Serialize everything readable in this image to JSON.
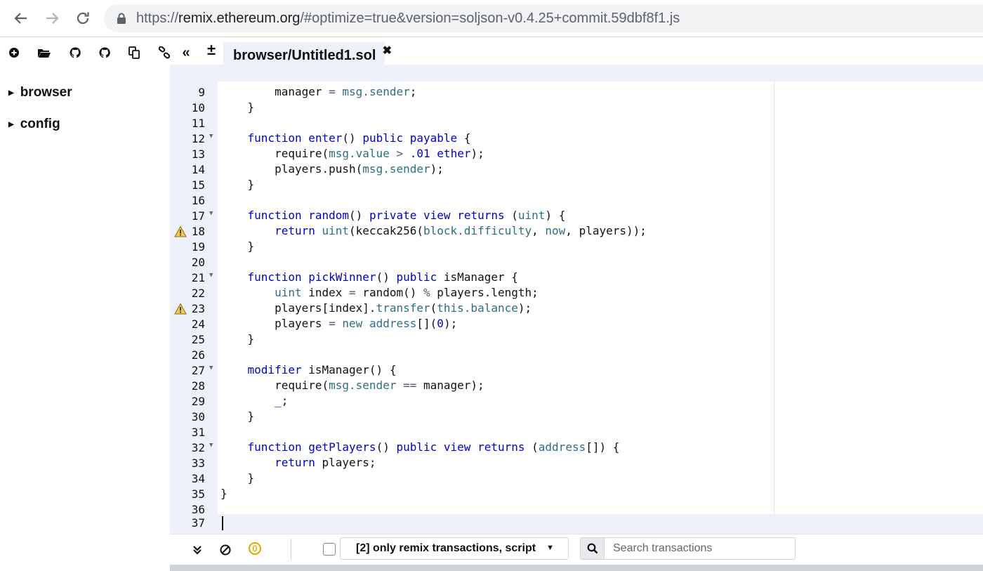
{
  "browser": {
    "url_scheme": "https://",
    "url_host": "remix.ethereum.org",
    "url_rest": "/#optimize=true&version=soljson-v0.4.25+commit.59dbf8f1.js"
  },
  "toolbar": {
    "icons": [
      "plus-circle-icon",
      "folder-open-icon",
      "github-icon",
      "github-icon",
      "copy-icon",
      "link-icon",
      "double-chevron-left-icon",
      "plus-minus-icon"
    ],
    "collapse_glyph": "«",
    "plus_minus_glyph": "±"
  },
  "file_explorer": {
    "items": [
      {
        "label": "browser"
      },
      {
        "label": "config"
      }
    ]
  },
  "editor": {
    "tab_label": "browser/Untitled1.sol",
    "tab_close": "✖",
    "lines": [
      {
        "num": "9",
        "fold": false,
        "warning": false,
        "tokens": [
          [
            "",
            "        manager "
          ],
          [
            "op",
            "="
          ],
          [
            "",
            " "
          ],
          [
            "vr",
            "msg.sender"
          ],
          [
            "",
            ";"
          ]
        ]
      },
      {
        "num": "10",
        "fold": false,
        "warning": false,
        "tokens": [
          [
            "",
            "    }"
          ]
        ]
      },
      {
        "num": "11",
        "fold": false,
        "warning": false,
        "tokens": []
      },
      {
        "num": "12",
        "fold": true,
        "warning": false,
        "tokens": [
          [
            "",
            "    "
          ],
          [
            "kw",
            "function"
          ],
          [
            "",
            " "
          ],
          [
            "kw",
            "enter"
          ],
          [
            "",
            "() "
          ],
          [
            "kw",
            "public"
          ],
          [
            "",
            " "
          ],
          [
            "kw",
            "payable"
          ],
          [
            "",
            " {"
          ]
        ]
      },
      {
        "num": "13",
        "fold": false,
        "warning": false,
        "tokens": [
          [
            "",
            "        require("
          ],
          [
            "vr",
            "msg.value"
          ],
          [
            "",
            " "
          ],
          [
            "op",
            ">"
          ],
          [
            "",
            " "
          ],
          [
            "nm",
            ".01"
          ],
          [
            "",
            " "
          ],
          [
            "kw",
            "ether"
          ],
          [
            "",
            ");"
          ]
        ]
      },
      {
        "num": "14",
        "fold": false,
        "warning": false,
        "tokens": [
          [
            "",
            "        players.push("
          ],
          [
            "vr",
            "msg.sender"
          ],
          [
            "",
            ");"
          ]
        ]
      },
      {
        "num": "15",
        "fold": false,
        "warning": false,
        "tokens": [
          [
            "",
            "    }"
          ]
        ]
      },
      {
        "num": "16",
        "fold": false,
        "warning": false,
        "tokens": []
      },
      {
        "num": "17",
        "fold": true,
        "warning": false,
        "tokens": [
          [
            "",
            "    "
          ],
          [
            "kw",
            "function"
          ],
          [
            "",
            " "
          ],
          [
            "kw",
            "random"
          ],
          [
            "",
            "() "
          ],
          [
            "kw",
            "private"
          ],
          [
            "",
            " "
          ],
          [
            "kw",
            "view"
          ],
          [
            "",
            " "
          ],
          [
            "kw",
            "returns"
          ],
          [
            "",
            " ("
          ],
          [
            "ty",
            "uint"
          ],
          [
            "",
            ") {"
          ]
        ]
      },
      {
        "num": "18",
        "fold": false,
        "warning": true,
        "tokens": [
          [
            "",
            "        "
          ],
          [
            "kw",
            "return"
          ],
          [
            "",
            " "
          ],
          [
            "ty",
            "uint"
          ],
          [
            "",
            "(keccak256("
          ],
          [
            "vr",
            "block.difficulty"
          ],
          [
            "",
            ", "
          ],
          [
            "vr",
            "now"
          ],
          [
            "",
            ", players));"
          ]
        ]
      },
      {
        "num": "19",
        "fold": false,
        "warning": false,
        "tokens": [
          [
            "",
            "    }"
          ]
        ]
      },
      {
        "num": "20",
        "fold": false,
        "warning": false,
        "tokens": []
      },
      {
        "num": "21",
        "fold": true,
        "warning": false,
        "tokens": [
          [
            "",
            "    "
          ],
          [
            "kw",
            "function"
          ],
          [
            "",
            " "
          ],
          [
            "kw",
            "pickWinner"
          ],
          [
            "",
            "() "
          ],
          [
            "kw",
            "public"
          ],
          [
            "",
            " isManager {"
          ]
        ]
      },
      {
        "num": "22",
        "fold": false,
        "warning": false,
        "tokens": [
          [
            "",
            "        "
          ],
          [
            "ty",
            "uint"
          ],
          [
            "",
            " index "
          ],
          [
            "op",
            "="
          ],
          [
            "",
            " random() "
          ],
          [
            "op",
            "%"
          ],
          [
            "",
            " players.length;"
          ]
        ]
      },
      {
        "num": "23",
        "fold": false,
        "warning": true,
        "tokens": [
          [
            "",
            "        players[index]."
          ],
          [
            "vr",
            "transfer"
          ],
          [
            "",
            "("
          ],
          [
            "vr",
            "this.balance"
          ],
          [
            "",
            ");"
          ]
        ]
      },
      {
        "num": "24",
        "fold": false,
        "warning": false,
        "tokens": [
          [
            "",
            "        players "
          ],
          [
            "op",
            "="
          ],
          [
            "",
            " "
          ],
          [
            "vr",
            "new"
          ],
          [
            "",
            " "
          ],
          [
            "ty",
            "address"
          ],
          [
            "",
            "[]("
          ],
          [
            "nm",
            "0"
          ],
          [
            "",
            ");"
          ]
        ]
      },
      {
        "num": "25",
        "fold": false,
        "warning": false,
        "tokens": [
          [
            "",
            "    }"
          ]
        ]
      },
      {
        "num": "26",
        "fold": false,
        "warning": false,
        "tokens": []
      },
      {
        "num": "27",
        "fold": true,
        "warning": false,
        "tokens": [
          [
            "",
            "    "
          ],
          [
            "kw",
            "modifier"
          ],
          [
            "",
            " isManager() {"
          ]
        ]
      },
      {
        "num": "28",
        "fold": false,
        "warning": false,
        "tokens": [
          [
            "",
            "        require("
          ],
          [
            "vr",
            "msg.sender"
          ],
          [
            "",
            " "
          ],
          [
            "op",
            "=="
          ],
          [
            "",
            " manager);"
          ]
        ]
      },
      {
        "num": "29",
        "fold": false,
        "warning": false,
        "tokens": [
          [
            "",
            "        "
          ],
          [
            "kw",
            "_"
          ],
          [
            "",
            ";"
          ]
        ]
      },
      {
        "num": "30",
        "fold": false,
        "warning": false,
        "tokens": [
          [
            "",
            "    }"
          ]
        ]
      },
      {
        "num": "31",
        "fold": false,
        "warning": false,
        "tokens": []
      },
      {
        "num": "32",
        "fold": true,
        "warning": false,
        "tokens": [
          [
            "",
            "    "
          ],
          [
            "kw",
            "function"
          ],
          [
            "",
            " "
          ],
          [
            "kw",
            "getPlayers"
          ],
          [
            "",
            "() "
          ],
          [
            "kw",
            "public"
          ],
          [
            "",
            " "
          ],
          [
            "kw",
            "view"
          ],
          [
            "",
            " "
          ],
          [
            "kw",
            "returns"
          ],
          [
            "",
            " ("
          ],
          [
            "ty",
            "address"
          ],
          [
            "",
            "[]) {"
          ]
        ]
      },
      {
        "num": "33",
        "fold": false,
        "warning": false,
        "tokens": [
          [
            "",
            "        "
          ],
          [
            "kw",
            "return"
          ],
          [
            "",
            " players;"
          ]
        ]
      },
      {
        "num": "34",
        "fold": false,
        "warning": false,
        "tokens": [
          [
            "",
            "    }"
          ]
        ]
      },
      {
        "num": "35",
        "fold": false,
        "warning": false,
        "tokens": [
          [
            "",
            "}"
          ]
        ]
      },
      {
        "num": "36",
        "fold": false,
        "warning": false,
        "tokens": []
      }
    ],
    "cursor_line": {
      "num": "37"
    }
  },
  "terminal": {
    "pending_count": "0",
    "filter_label": "[2] only remix transactions, script",
    "search_placeholder": "Search transactions"
  },
  "colors": {
    "keyword": "#0000cc",
    "builtin": "#2e6e7e",
    "gutter_bg": "#eef0fa",
    "warning": "#e0a800"
  }
}
